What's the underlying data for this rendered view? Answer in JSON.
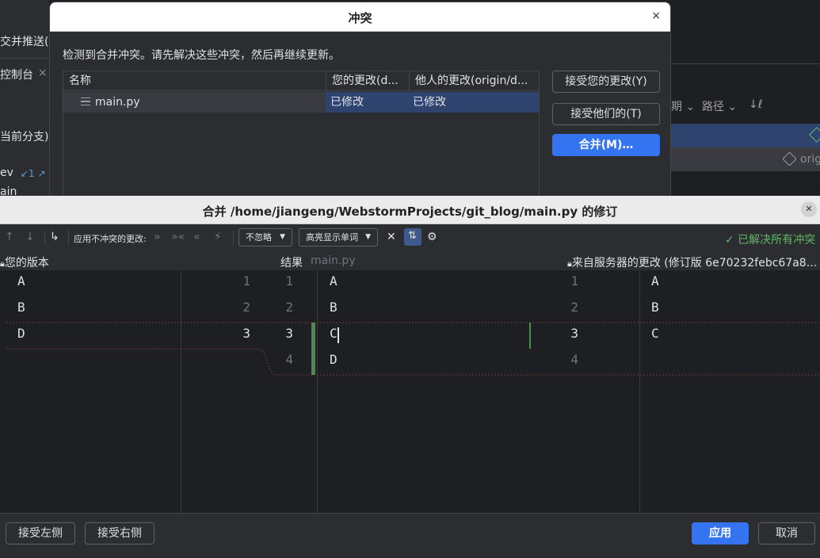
{
  "background_ide": {
    "left_items": [
      "交并推送(P",
      "控制台",
      "当前分支)",
      "ev",
      "ain"
    ],
    "console_close": "×",
    "counter": "↙1 ↗",
    "right_items": [
      "期 ⌄",
      "路径 ⌄",
      "↓ℓ"
    ],
    "origin_tag": "origi"
  },
  "conflict_dialog": {
    "title": "冲突",
    "close": "×",
    "message": "检测到合并冲突。请先解决这些冲突，然后再继续更新。",
    "columns": [
      "名称",
      "您的更改(d...",
      "他人的更改(origin/d..."
    ],
    "rows": [
      {
        "name": "main.py",
        "yours": "已修改",
        "theirs": "已修改"
      }
    ],
    "buttons": {
      "accept_yours": "接受您的更改(Y)",
      "accept_theirs": "接受他们的(T)",
      "merge": "合并(M)…"
    }
  },
  "merge_window": {
    "title": "合并 /home/jiangeng/WebstormProjects/git_blog/main.py 的修订",
    "close": "✕",
    "toolbar": {
      "apply_nonconflicting": "应用不冲突的更改:",
      "ignore_dropdown": "不忽略",
      "highlight_dropdown": "高亮显示单词",
      "status": "✓ 已解决所有冲突"
    },
    "headers": {
      "left": "您的版本",
      "center": "结果",
      "center_file": "main.py",
      "right": "来自服务器的更改 (修订版 6e70232febc67a8..."
    },
    "left_lines": [
      "A",
      "B",
      "D"
    ],
    "left_numbers": [
      "1",
      "2",
      "3"
    ],
    "center_numbers_left": [
      "1",
      "2",
      "3",
      "4"
    ],
    "center_lines": [
      "A",
      "B",
      "C",
      "D"
    ],
    "center_numbers_right": [
      "1",
      "2",
      "3",
      "4"
    ],
    "right_lines": [
      "A",
      "B",
      "C"
    ],
    "footer": {
      "accept_left": "接受左侧",
      "accept_right": "接受右侧",
      "apply": "应用",
      "cancel": "取消"
    }
  },
  "colors": {
    "accent": "#3574f0",
    "success": "#5fb865",
    "selected_row": "#2e436e"
  }
}
